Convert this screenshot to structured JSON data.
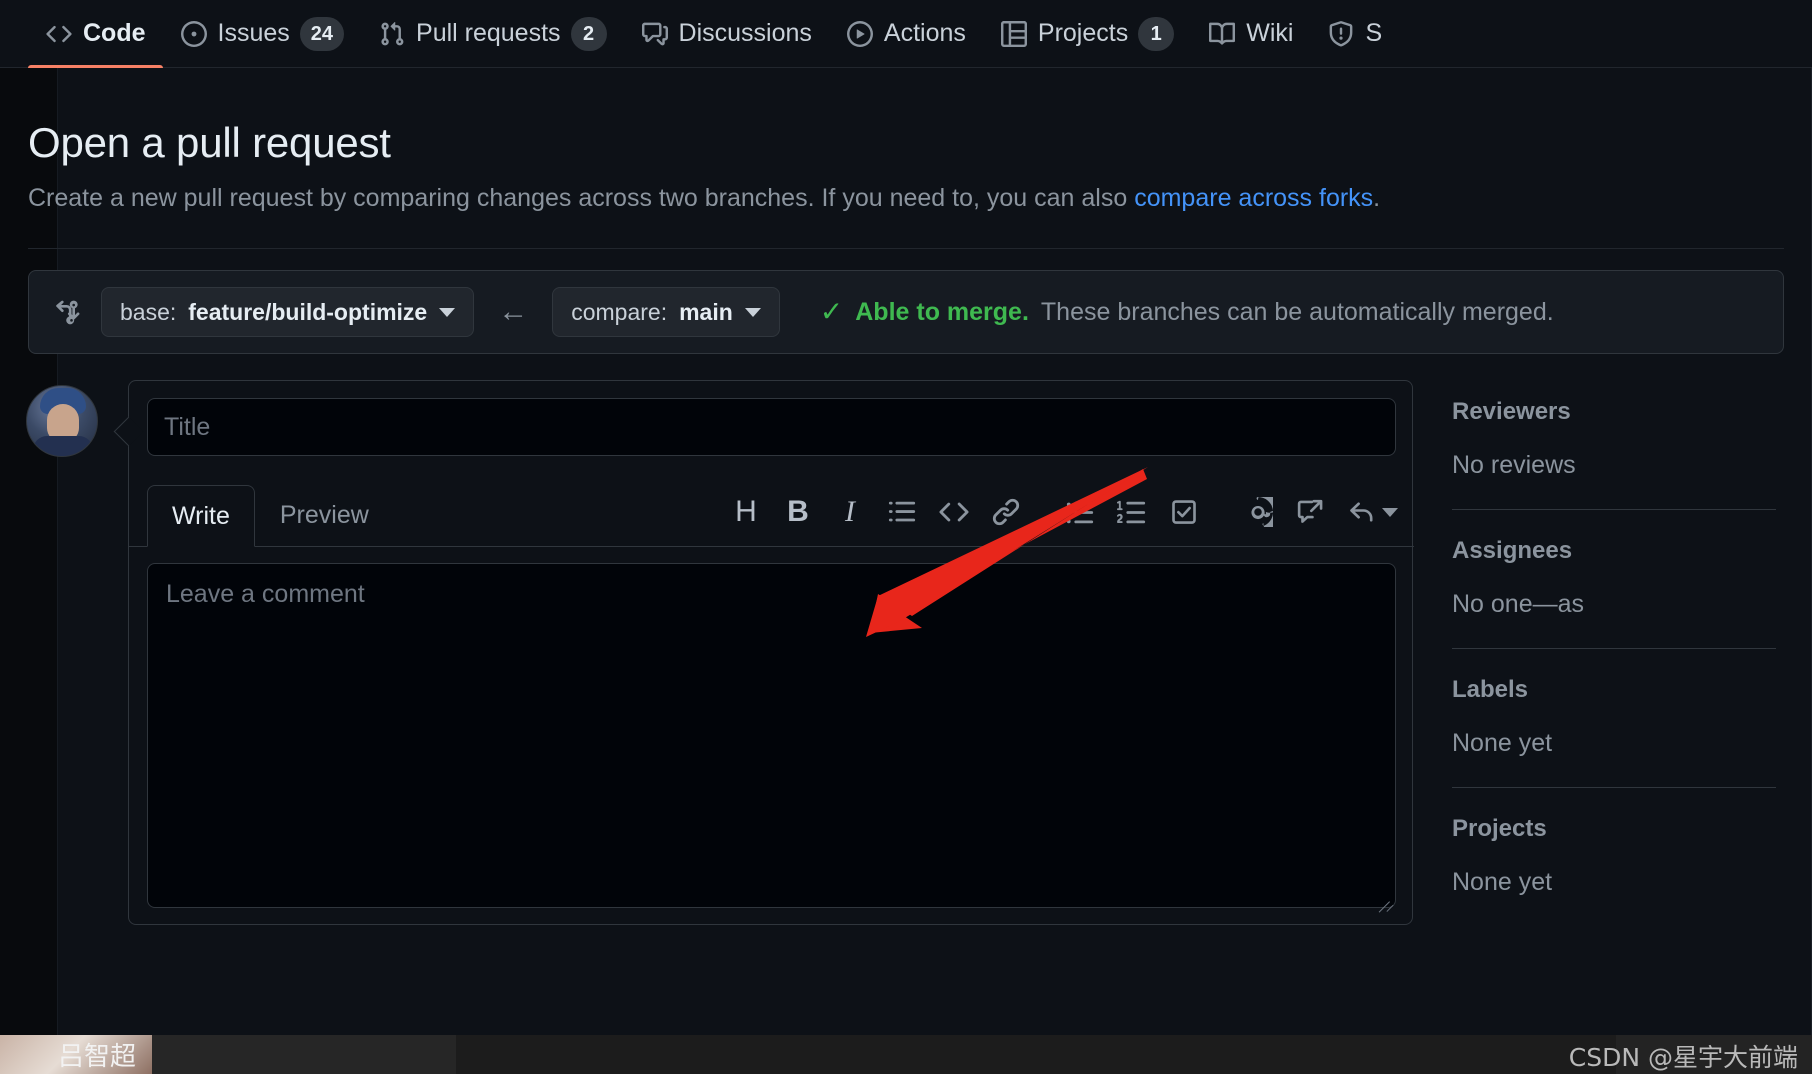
{
  "repo_nav": {
    "items": [
      {
        "label": "Code",
        "icon": "code-icon",
        "count": null,
        "selected": true
      },
      {
        "label": "Issues",
        "icon": "issue-opened-icon",
        "count": "24",
        "selected": false
      },
      {
        "label": "Pull requests",
        "icon": "git-pull-request-icon",
        "count": "2",
        "selected": false
      },
      {
        "label": "Discussions",
        "icon": "comment-discussion-icon",
        "count": null,
        "selected": false
      },
      {
        "label": "Actions",
        "icon": "play-icon",
        "count": null,
        "selected": false
      },
      {
        "label": "Projects",
        "icon": "table-icon",
        "count": "1",
        "selected": false
      },
      {
        "label": "Wiki",
        "icon": "book-icon",
        "count": null,
        "selected": false
      },
      {
        "label": "S",
        "icon": "shield-icon",
        "count": null,
        "selected": false
      }
    ]
  },
  "page": {
    "title": "Open a pull request",
    "subtitle_before": "Create a new pull request by comparing changes across two branches. If you need to, you can also ",
    "subtitle_link": "compare across forks",
    "subtitle_after": "."
  },
  "compare": {
    "base_prefix": "base: ",
    "base_branch": "feature/build-optimize",
    "direction_arrow": "←",
    "compare_prefix": "compare: ",
    "compare_branch": "main",
    "check_glyph": "✓",
    "merge_status": "Able to merge.",
    "merge_detail": "These branches can be automatically merged."
  },
  "composer": {
    "title_placeholder": "Title",
    "tabs": [
      {
        "label": "Write",
        "active": true
      },
      {
        "label": "Preview",
        "active": false
      }
    ],
    "toolbar": [
      {
        "name": "heading-icon",
        "glyph": "H"
      },
      {
        "name": "bold-icon",
        "glyph": "B"
      },
      {
        "name": "italic-icon",
        "glyph": "I"
      },
      {
        "name": "quote-icon",
        "glyph": ""
      },
      {
        "name": "code-icon",
        "glyph": ""
      },
      {
        "name": "link-icon",
        "glyph": ""
      },
      {
        "name": "unordered-list-icon",
        "glyph": ""
      },
      {
        "name": "ordered-list-icon",
        "glyph": ""
      },
      {
        "name": "task-list-icon",
        "glyph": ""
      },
      {
        "name": "mention-icon",
        "glyph": ""
      },
      {
        "name": "reference-icon",
        "glyph": ""
      },
      {
        "name": "saved-reply-icon",
        "glyph": ""
      }
    ],
    "comment_placeholder": "Leave a comment"
  },
  "sidebar": {
    "blocks": [
      {
        "heading": "Reviewers",
        "value": "No reviews"
      },
      {
        "heading": "Assignees",
        "value": "No one—as"
      },
      {
        "heading": "Labels",
        "value": "None yet"
      },
      {
        "heading": "Projects",
        "value": "None yet"
      }
    ]
  },
  "desktop": {
    "taskbar_label": "吕智超",
    "watermark": "CSDN @星宇大前端"
  },
  "colors": {
    "bg": "#0d1117",
    "accent_tab": "#f78166",
    "link": "#4493f8",
    "success": "#3fb950",
    "border": "#30363d",
    "annotation_arrow": "#e8261b"
  }
}
